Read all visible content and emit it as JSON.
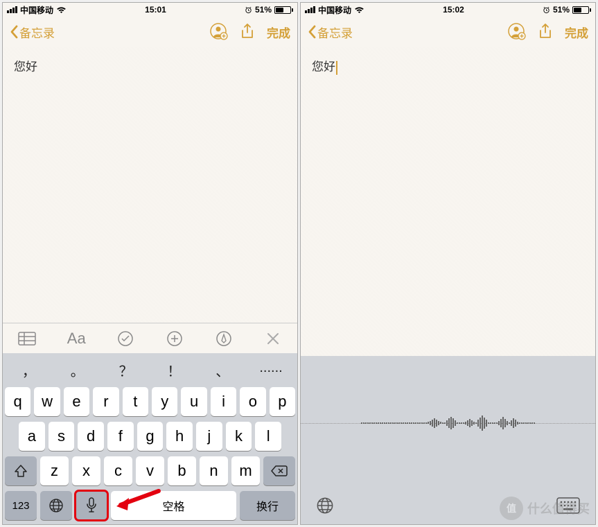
{
  "left": {
    "status": {
      "carrier": "中国移动",
      "time": "15:01",
      "battery": "51%"
    },
    "nav": {
      "back": "备忘录",
      "done": "完成"
    },
    "note_text": "您好",
    "toolbar": {
      "format": "Aa"
    },
    "keyboard": {
      "punct": [
        "，",
        "。",
        "？",
        "！",
        "、",
        "......"
      ],
      "row1": [
        "q",
        "w",
        "e",
        "r",
        "t",
        "y",
        "u",
        "i",
        "o",
        "p"
      ],
      "row2": [
        "a",
        "s",
        "d",
        "f",
        "g",
        "h",
        "j",
        "k",
        "l"
      ],
      "row3": [
        "z",
        "x",
        "c",
        "v",
        "b",
        "n",
        "m"
      ],
      "num": "123",
      "space": "空格",
      "return": "换行"
    }
  },
  "right": {
    "status": {
      "carrier": "中国移动",
      "time": "15:02",
      "battery": "51%"
    },
    "nav": {
      "back": "备忘录",
      "done": "完成"
    },
    "note_text": "您好"
  },
  "watermark": {
    "icon": "值",
    "text": "什么值得买"
  }
}
